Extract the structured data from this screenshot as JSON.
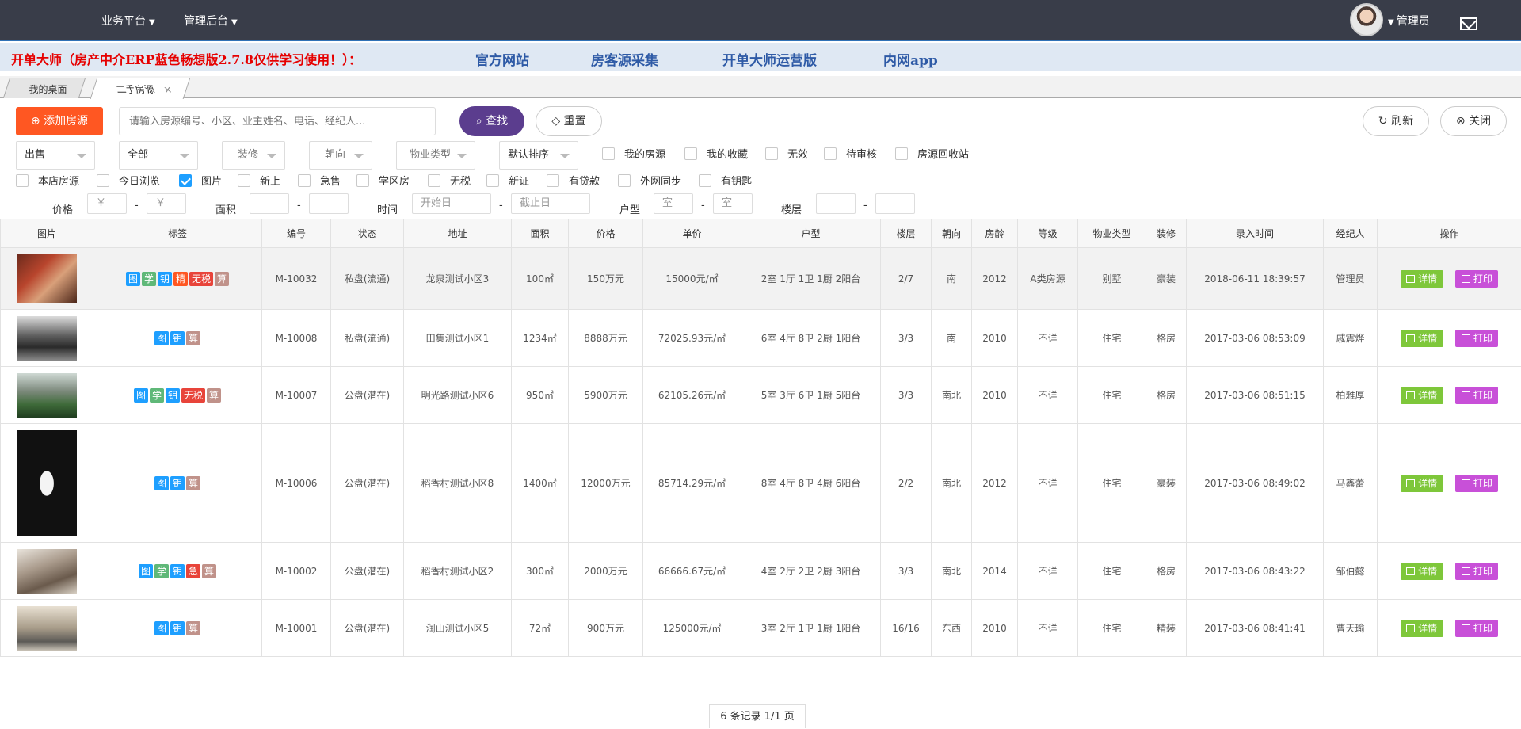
{
  "nav": {
    "business": "业务平台",
    "admin_backend": "管理后台",
    "user": "管理员"
  },
  "banner": {
    "title": "开单大师（房产中介ERP蓝色畅想版2.7.8仅供学习使用！）：",
    "links": [
      "官方网站",
      "房客源采集",
      "开单大师运营版",
      "内网app"
    ]
  },
  "tabs": [
    {
      "label": "我的桌面"
    },
    {
      "label": "二手房源"
    }
  ],
  "toolbar": {
    "add": "添加房源",
    "search_placeholder": "请输入房源编号、小区、业主姓名、电话、经纪人...",
    "search": "查找",
    "reset": "重置",
    "refresh": "刷新",
    "close": "关闭"
  },
  "selects": [
    "出售",
    "全部",
    "装修",
    "朝向",
    "物业类型",
    "默认排序"
  ],
  "checks_row1": [
    "我的房源",
    "我的收藏",
    "无效",
    "待审核",
    "房源回收站"
  ],
  "checks_row2": [
    "本店房源",
    "今日浏览",
    "图片",
    "新上",
    "急售",
    "学区房",
    "无税",
    "新证",
    "有贷款",
    "外网同步",
    "有钥匙"
  ],
  "filters": {
    "price": "价格",
    "area": "面积",
    "time": "时间",
    "layout": "户型",
    "floor": "楼层",
    "yen": "￥",
    "start_date": "开始日",
    "end_date": "截止日",
    "room": "室",
    "dash": "-"
  },
  "columns": [
    "图片",
    "标签",
    "编号",
    "状态",
    "地址",
    "面积",
    "价格",
    "单价",
    "户型",
    "楼层",
    "朝向",
    "房龄",
    "等级",
    "物业类型",
    "装修",
    "录入时间",
    "经纪人",
    "操作"
  ],
  "tag_colors": {
    "图": "#1e9fff",
    "学": "#5fb878",
    "钥": "#1e9fff",
    "精": "#ff5722",
    "无税": "#e8443a",
    "急": "#e8443a",
    "算": "#c0928a"
  },
  "ops": {
    "detail": "详情",
    "print": "打印"
  },
  "rows": [
    {
      "tags": [
        "图",
        "学",
        "钥",
        "精",
        "无税",
        "算"
      ],
      "code": "M-10032",
      "status": "私盘(流通)",
      "address": "龙泉测试小区3",
      "area": "100㎡",
      "price": "150万元",
      "unit_price": "15000元/㎡",
      "layout": "2室 1厅 1卫 1厨 2阳台",
      "floor": "2/7",
      "orientation": "南",
      "year": "2012",
      "grade": "A类房源",
      "property_type": "别墅",
      "decoration": "豪装",
      "entry_time": "2018-06-11 18:39:57",
      "agent": "管理员"
    },
    {
      "tags": [
        "图",
        "钥",
        "算"
      ],
      "code": "M-10008",
      "status": "私盘(流通)",
      "address": "田集测试小区1",
      "area": "1234㎡",
      "price": "8888万元",
      "unit_price": "72025.93元/㎡",
      "layout": "6室 4厅 8卫 2厨 1阳台",
      "floor": "3/3",
      "orientation": "南",
      "year": "2010",
      "grade": "不详",
      "property_type": "住宅",
      "decoration": "格房",
      "entry_time": "2017-03-06 08:53:09",
      "agent": "戚震烨"
    },
    {
      "tags": [
        "图",
        "学",
        "钥",
        "无税",
        "算"
      ],
      "code": "M-10007",
      "status": "公盘(潜在)",
      "address": "明光路测试小区6",
      "area": "950㎡",
      "price": "5900万元",
      "unit_price": "62105.26元/㎡",
      "layout": "5室 3厅 6卫 1厨 5阳台",
      "floor": "3/3",
      "orientation": "南北",
      "year": "2010",
      "grade": "不详",
      "property_type": "住宅",
      "decoration": "格房",
      "entry_time": "2017-03-06 08:51:15",
      "agent": "柏雅厚"
    },
    {
      "tags": [
        "图",
        "钥",
        "算"
      ],
      "code": "M-10006",
      "status": "公盘(潜在)",
      "address": "稻香村测试小区8",
      "area": "1400㎡",
      "price": "12000万元",
      "unit_price": "85714.29元/㎡",
      "layout": "8室 4厅 8卫 4厨 6阳台",
      "floor": "2/2",
      "orientation": "南北",
      "year": "2012",
      "grade": "不详",
      "property_type": "住宅",
      "decoration": "豪装",
      "entry_time": "2017-03-06 08:49:02",
      "agent": "马鑫蕾"
    },
    {
      "tags": [
        "图",
        "学",
        "钥",
        "急",
        "算"
      ],
      "code": "M-10002",
      "status": "公盘(潜在)",
      "address": "稻香村测试小区2",
      "area": "300㎡",
      "price": "2000万元",
      "unit_price": "66666.67元/㎡",
      "layout": "4室 2厅 2卫 2厨 3阳台",
      "floor": "3/3",
      "orientation": "南北",
      "year": "2014",
      "grade": "不详",
      "property_type": "住宅",
      "decoration": "格房",
      "entry_time": "2017-03-06 08:43:22",
      "agent": "邹伯懿"
    },
    {
      "tags": [
        "图",
        "钥",
        "算"
      ],
      "code": "M-10001",
      "status": "公盘(潜在)",
      "address": "润山测试小区5",
      "area": "72㎡",
      "price": "900万元",
      "unit_price": "125000元/㎡",
      "layout": "3室 2厅 1卫 1厨 1阳台",
      "floor": "16/16",
      "orientation": "东西",
      "year": "2010",
      "grade": "不详",
      "property_type": "住宅",
      "decoration": "精装",
      "entry_time": "2017-03-06 08:41:41",
      "agent": "曹天瑜"
    }
  ],
  "pagination": "6 条记录 1/1 页"
}
